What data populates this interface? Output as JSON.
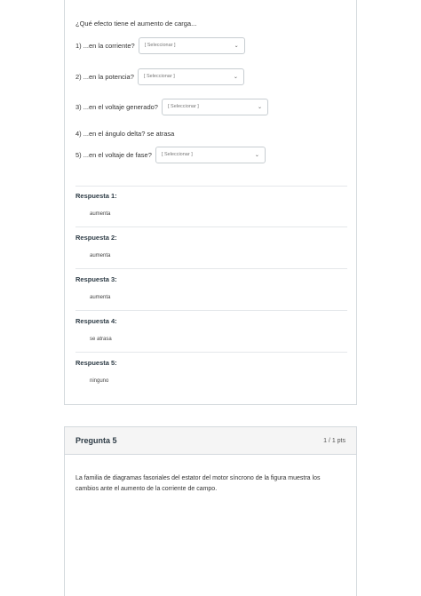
{
  "question4": {
    "prompt": "¿Qué efecto tiene el aumento de carga...",
    "rows": [
      {
        "label": "1) ...en la corriente?",
        "select": "[ Seleccionar ]",
        "chevron": "⌄"
      },
      {
        "label": "2) ...en la potencia?",
        "select": "[ Seleccionar ]",
        "chevron": "⌄"
      },
      {
        "label": "3) ...en el voltaje generado?",
        "select": "[ Seleccionar ]",
        "chevron": "⌄"
      },
      {
        "label": "4) ...en el ángulo delta? se atrasa"
      },
      {
        "label": "5) ...en el voltaje de fase?",
        "select": "[ Seleccionar ]",
        "chevron": "⌄"
      }
    ],
    "answers": [
      {
        "title": "Respuesta 1:",
        "value": "aumenta"
      },
      {
        "title": "Respuesta 2:",
        "value": "aumenta"
      },
      {
        "title": "Respuesta 3:",
        "value": "aumenta"
      },
      {
        "title": "Respuesta 4:",
        "value": "se atrasa"
      },
      {
        "title": "Respuesta 5:",
        "value": "ninguno"
      }
    ]
  },
  "question5": {
    "title": "Pregunta 5",
    "points": "1 / 1 pts",
    "text": "La familia de diagramas fasoriales del estator del motor síncrono de la figura muestra los cambios ante el aumento de la corriente de campo."
  }
}
